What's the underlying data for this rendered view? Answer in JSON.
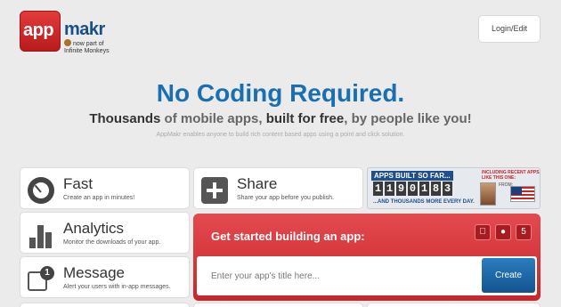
{
  "header": {
    "logo_app": "app",
    "logo_makr": "makr",
    "logo_sub_line1": "now part of",
    "logo_sub_line2": "Infinite Monkeys",
    "login_label": "Login/Edit"
  },
  "hero": {
    "headline": "No Coding Required.",
    "sub_part1": "Thousands",
    "sub_part2": " of mobile apps, ",
    "sub_part3": "built for free",
    "sub_part4": ", by people like you!",
    "tagline": "AppMakr enables anyone to build rich content based apps using a point and click solution."
  },
  "features": [
    {
      "title": "Fast",
      "desc": "Create an app in minutes!",
      "icon": "speedometer-icon"
    },
    {
      "title": "Share",
      "desc": "Share your app before you publish.",
      "icon": "plus-icon"
    },
    {
      "title": "Analytics",
      "desc": "Monitor the downloads of your app.",
      "icon": "bar-chart-icon"
    },
    {
      "title": "Message",
      "desc": "Alert your users with in-app messages.",
      "icon": "message-icon",
      "badge": "1"
    }
  ],
  "counter": {
    "header": "APPS BUILT SO FAR...",
    "digits": [
      "1",
      "1",
      "9",
      "0",
      "1",
      "8",
      "3"
    ],
    "footer": "...AND THOUSANDS MORE EVERY DAY.",
    "note": "INCLUDING RECENT APPS, LIKE THIS ONE:",
    "from_label": "FROM:"
  },
  "get_started": {
    "title": "Get started building an app:",
    "platforms": [
      "apple-icon",
      "android-icon",
      "html5-icon"
    ],
    "input_placeholder": "Enter your app's title here...",
    "create_label": "Create"
  },
  "colors": {
    "accent_blue": "#1a6fb0",
    "brand_red": "#d6333a",
    "background": "#ebebeb"
  }
}
